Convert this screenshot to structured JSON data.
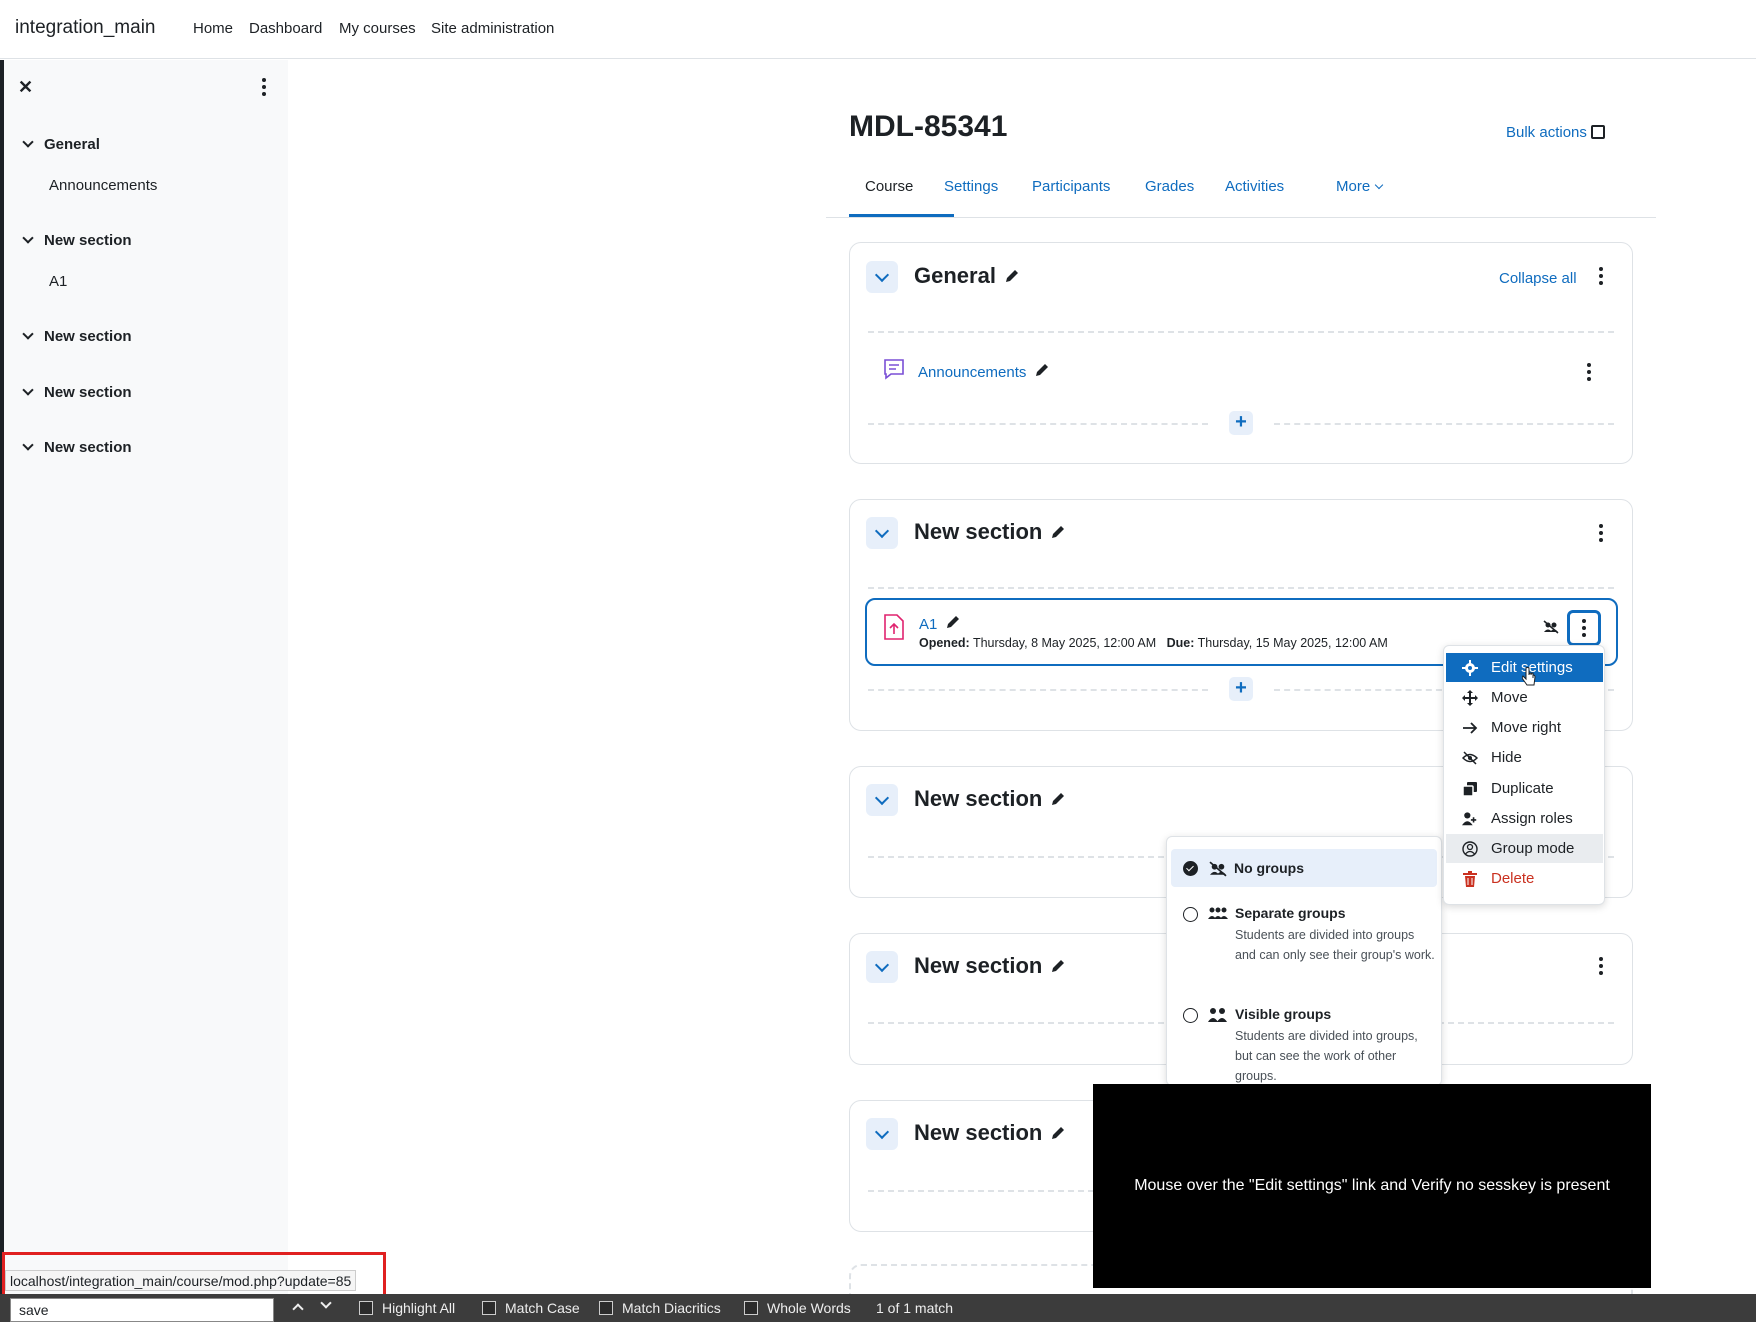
{
  "navbar": {
    "site_name": "integration_main",
    "links": [
      "Home",
      "Dashboard",
      "My courses",
      "Site administration"
    ]
  },
  "drawer": {
    "close": "✕",
    "sections": [
      {
        "title": "General",
        "items": [
          "Announcements"
        ]
      },
      {
        "title": "New section",
        "items": [
          "A1"
        ]
      },
      {
        "title": "New section",
        "items": []
      },
      {
        "title": "New section",
        "items": []
      },
      {
        "title": "New section",
        "items": []
      }
    ]
  },
  "course": {
    "title": "MDL-85341",
    "bulk_actions": "Bulk actions",
    "tabs": [
      "Course",
      "Settings",
      "Participants",
      "Grades",
      "Activities",
      "More"
    ],
    "active_tab": "Course"
  },
  "sections": {
    "general": {
      "title": "General",
      "collapse_all": "Collapse all",
      "activity": "Announcements"
    },
    "s1": {
      "title": "New section",
      "activity": "A1",
      "opened_label": "Opened:",
      "opened_value": "Thursday, 8 May 2025, 12:00 AM",
      "due_label": "Due:",
      "due_value": "Thursday, 15 May 2025, 12:00 AM"
    },
    "s2": {
      "title": "New section"
    },
    "s3": {
      "title": "New section"
    },
    "s4": {
      "title": "New section"
    }
  },
  "activity_menu": {
    "items": [
      {
        "label": "Edit settings",
        "icon": "gear-icon"
      },
      {
        "label": "Move",
        "icon": "move-icon"
      },
      {
        "label": "Move right",
        "icon": "arrow-right-icon"
      },
      {
        "label": "Hide",
        "icon": "eye-slash-icon"
      },
      {
        "label": "Duplicate",
        "icon": "copy-icon"
      },
      {
        "label": "Assign roles",
        "icon": "user-plus-icon"
      },
      {
        "label": "Group mode",
        "icon": "group-circle-icon"
      },
      {
        "label": "Delete",
        "icon": "trash-icon"
      }
    ],
    "highlighted": "Edit settings",
    "delete_color": "#ca3120"
  },
  "group_mode": {
    "options": [
      {
        "title": "No groups",
        "desc": "",
        "selected": true
      },
      {
        "title": "Separate groups",
        "desc": "Students are divided into groups and can only see their group's work.",
        "selected": false
      },
      {
        "title": "Visible groups",
        "desc": "Students are divided into groups, but can see the work of other groups.",
        "selected": false
      }
    ]
  },
  "overlay": {
    "text": "Mouse over the \"Edit settings\" link and Verify no sesskey is present"
  },
  "status_url": "localhost/integration_main/course/mod.php?update=85",
  "findbar": {
    "query": "save",
    "highlight_all": "Highlight All",
    "match_case": "Match Case",
    "match_diacritics": "Match Diacritics",
    "whole_words": "Whole Words",
    "result": "1 of 1 match"
  },
  "colors": {
    "accent": "#0f6cbf",
    "danger": "#ca3120",
    "text": "#1d2125"
  }
}
